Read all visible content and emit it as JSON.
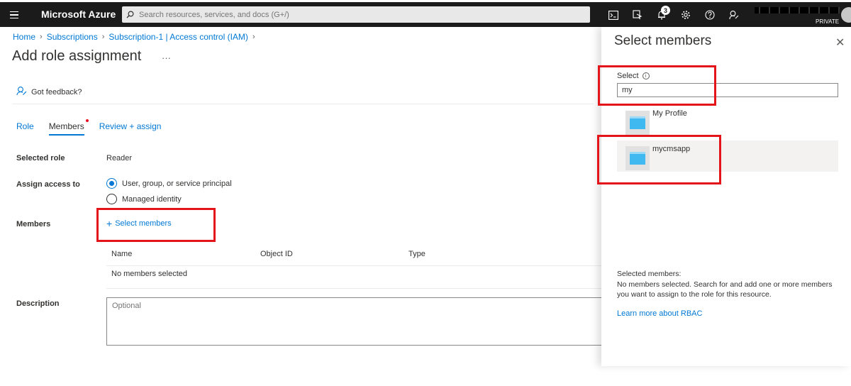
{
  "topbar": {
    "brand": "Microsoft Azure",
    "search_placeholder": "Search resources, services, and docs (G+/)",
    "notification_count": "3",
    "account_tag": "PRIVATE"
  },
  "breadcrumb": [
    "Home",
    "Subscriptions",
    "Subscription-1 | Access control (IAM)"
  ],
  "page": {
    "title": "Add role assignment",
    "more": "···",
    "feedback": "Got feedback?"
  },
  "tabs": [
    "Role",
    "Members",
    "Review + assign"
  ],
  "form": {
    "selected_role_label": "Selected role",
    "selected_role_value": "Reader",
    "assign_access_label": "Assign access to",
    "option_user": "User, group, or service principal",
    "option_managed": "Managed identity",
    "members_label": "Members",
    "select_members": "Select members",
    "columns": [
      "Name",
      "Object ID",
      "Type"
    ],
    "no_members": "No members selected",
    "description_label": "Description",
    "description_placeholder": "Optional"
  },
  "panel": {
    "title": "Select members",
    "select_label": "Select",
    "search_value": "my",
    "results": [
      {
        "name": "My Profile"
      },
      {
        "name": "mycmsapp"
      }
    ],
    "selected_members_heading": "Selected members:",
    "selected_members_text": "No members selected. Search for and add one or more members you want to assign to the role for this resource.",
    "learn_more": "Learn more about RBAC"
  },
  "colors": {
    "accent": "#0078d4",
    "highlight": "#e3151a",
    "topbar": "#1b1b1b"
  }
}
